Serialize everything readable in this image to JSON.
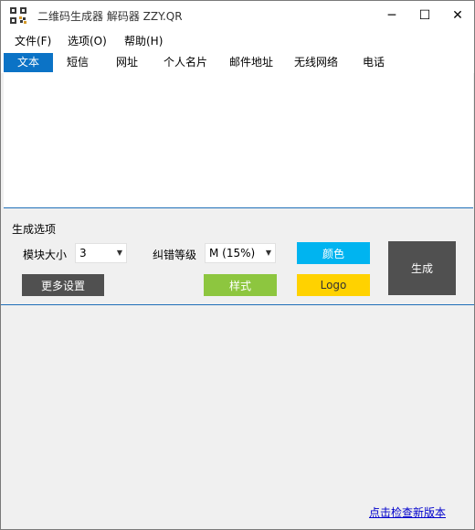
{
  "window": {
    "title": "二维码生成器 解码器 ZZY.QR",
    "min_glyph": "─",
    "max_glyph": "☐",
    "close_glyph": "✕"
  },
  "menu": [
    {
      "label": "文件(F)"
    },
    {
      "label": "选项(O)"
    },
    {
      "label": "帮助(H)"
    }
  ],
  "tabs": [
    {
      "label": "文本",
      "active": true
    },
    {
      "label": "短信"
    },
    {
      "label": "网址"
    },
    {
      "label": "个人名片"
    },
    {
      "label": "邮件地址"
    },
    {
      "label": "无线网络"
    },
    {
      "label": "电话"
    }
  ],
  "options": {
    "title": "生成选项",
    "module_size_label": "模块大小",
    "module_size_value": "3",
    "error_level_label": "纠错等级",
    "error_level_value": "M (15%)",
    "color_button": "颜色",
    "more_button": "更多设置",
    "style_button": "样式",
    "logo_button": "Logo",
    "generate_button": "生成"
  },
  "footer": {
    "update_link": "点击检查新版本"
  },
  "colors": {
    "accent": "#0b73c6",
    "style": "#8dc63f",
    "logo": "#ffd200",
    "color": "#00b4f0",
    "dark": "#505050"
  }
}
